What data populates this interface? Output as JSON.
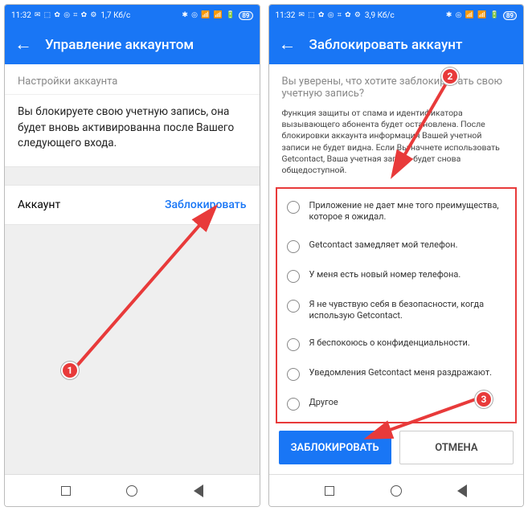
{
  "status": {
    "time": "11:32",
    "icons_left": "✉ ⬚ ✿ ◎ ⌗ ✿ ⚙",
    "speed_left": "1,7 Кб/с",
    "speed_right": "3,9 Кб/с",
    "icons_right": "✱ ◎ 📶 📶 🔋",
    "battery": "89"
  },
  "left": {
    "title": "Управление аккаунтом",
    "section_label": "Настройки аккаунта",
    "info_text": "Вы блокируете свою учетную запись, она будет вновь активированна после Вашего следующего входа.",
    "account_label": "Аккаунт",
    "block_action": "Заблокировать"
  },
  "right": {
    "title": "Заблокировать аккаунт",
    "confirm_question": "Вы уверены, что хотите заблокировать свою учетную запись?",
    "small_text": "Функция защиты от спама и идентификатора вызывающего абонента будет остановлена. После блокировки аккаунта информация Вашей учетной записи не будет видна. Если Вы начнете использовать Getcontact, Ваша учетная запись будет снова общедоступной.",
    "reasons": [
      "Приложение не дает мне того преимущества, которое я ожидал.",
      "Getcontact замедляет мой телефон.",
      "У меня есть новый номер телефона.",
      "Я не чувствую себя в безопасности, когда использую Getcontact.",
      "Я беспокоюсь о конфиденциальности.",
      "Уведомления Getcontact меня раздражают.",
      "Другое"
    ],
    "btn_block": "ЗАБЛОКИРОВАТЬ",
    "btn_cancel": "ОТМЕНА"
  },
  "steps": {
    "s1": "1",
    "s2": "2",
    "s3": "3"
  }
}
